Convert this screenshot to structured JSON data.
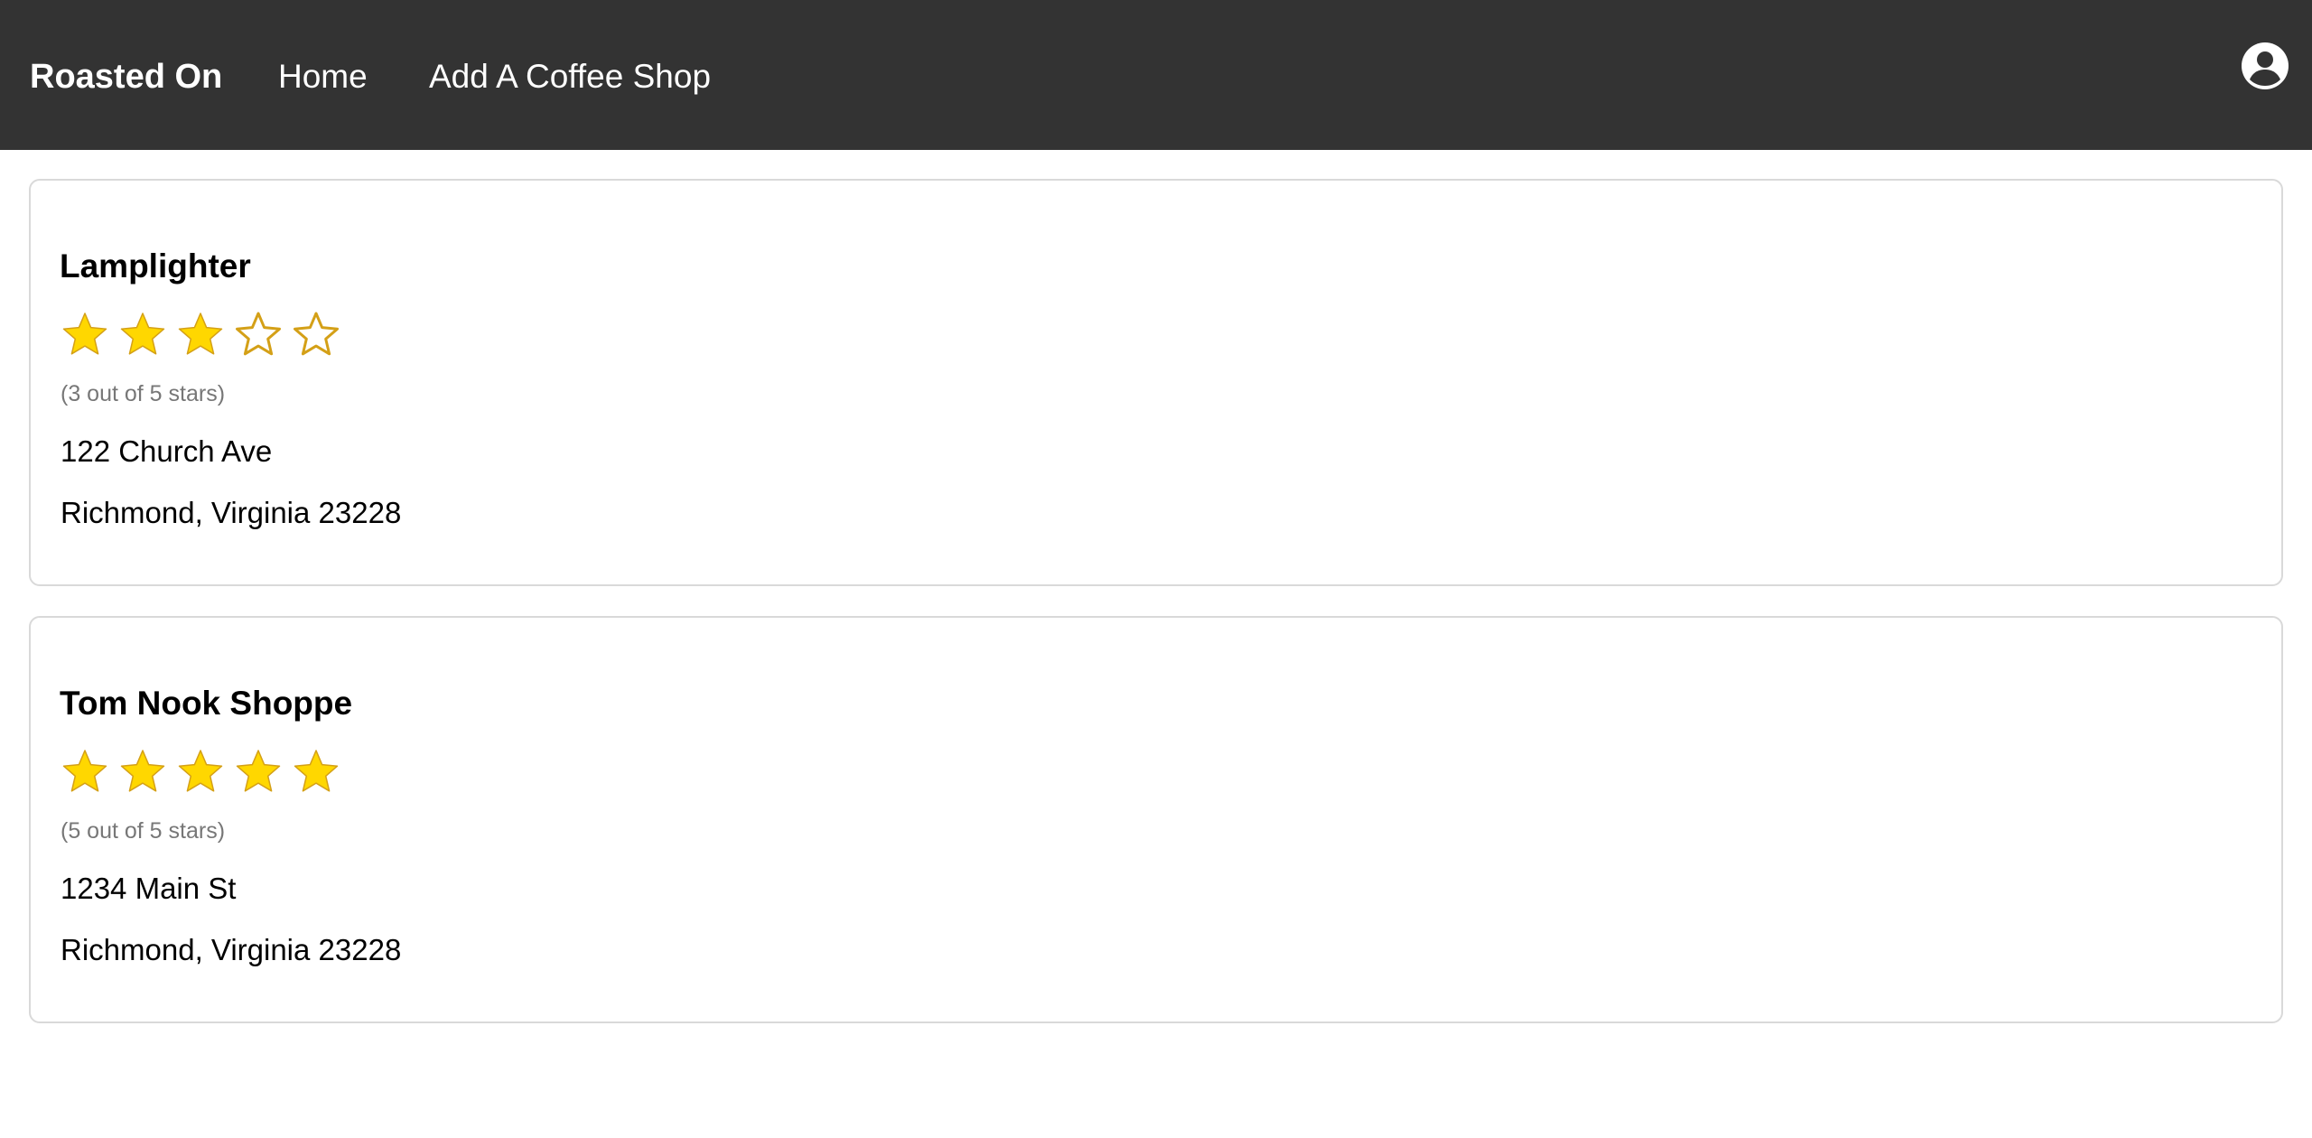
{
  "navbar": {
    "brand": "Roasted On",
    "links": [
      {
        "label": "Home"
      },
      {
        "label": "Add A Coffee Shop"
      }
    ],
    "account_icon": "user-circle-icon",
    "background_color": "#333333"
  },
  "shops": [
    {
      "name": "Lamplighter",
      "rating": 3,
      "max_rating": 5,
      "rating_text": "(3 out of 5 stars)",
      "street": "122 Church Ave",
      "city_line": "Richmond, Virginia 23228"
    },
    {
      "name": "Tom Nook Shoppe",
      "rating": 5,
      "max_rating": 5,
      "rating_text": "(5 out of 5 stars)",
      "street": "1234 Main St",
      "city_line": "Richmond, Virginia 23228"
    }
  ],
  "colors": {
    "star_fill": "#FFD700",
    "star_outline": "#D4A017",
    "card_border": "#d9d9d9",
    "muted_text": "#777777"
  }
}
